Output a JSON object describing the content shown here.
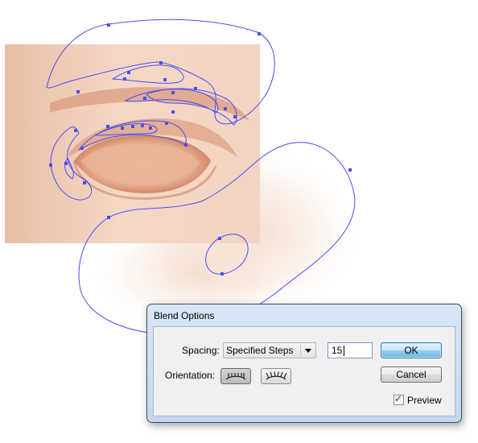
{
  "dialog": {
    "title": "Blend Options",
    "spacing_label": "Spacing:",
    "spacing_value": "Specified Steps",
    "steps_value": "15",
    "orientation_label": "Orientation:",
    "ok_label": "OK",
    "cancel_label": "Cancel",
    "preview_label": "Preview",
    "preview_checked": true
  },
  "icons": {
    "align_page": "align-to-page-icon",
    "align_path": "align-to-path-icon",
    "dropdown": "chevron-down-icon",
    "check": "checkmark-icon"
  }
}
